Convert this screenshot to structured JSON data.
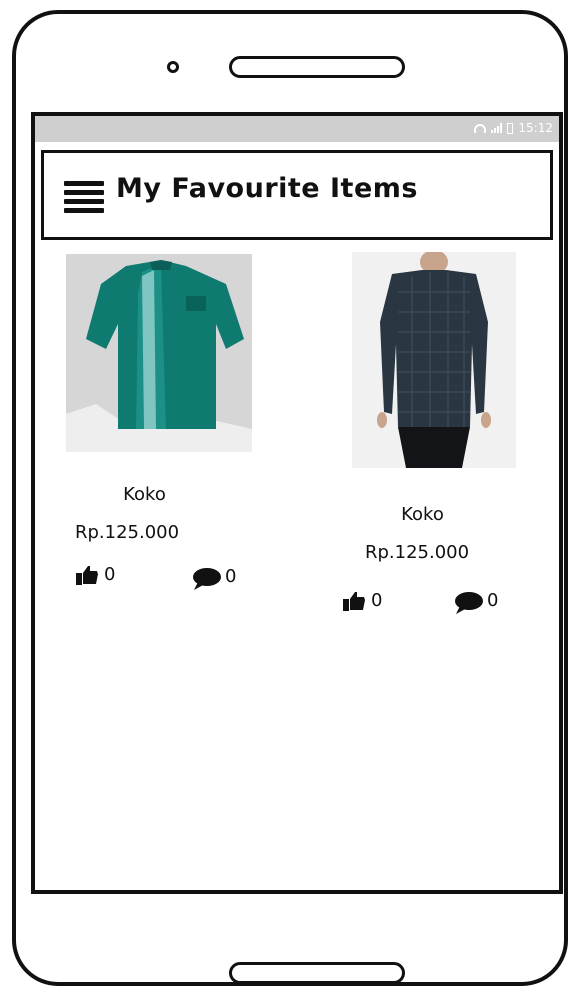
{
  "statusbar": {
    "time": "15:12"
  },
  "appbar": {
    "title": "My Favourite Items"
  },
  "items": [
    {
      "name": "Koko",
      "price": "Rp.125.000",
      "likes": "0",
      "comments": "0"
    },
    {
      "name": "Koko",
      "price": "Rp.125.000",
      "likes": "0",
      "comments": "0"
    }
  ]
}
